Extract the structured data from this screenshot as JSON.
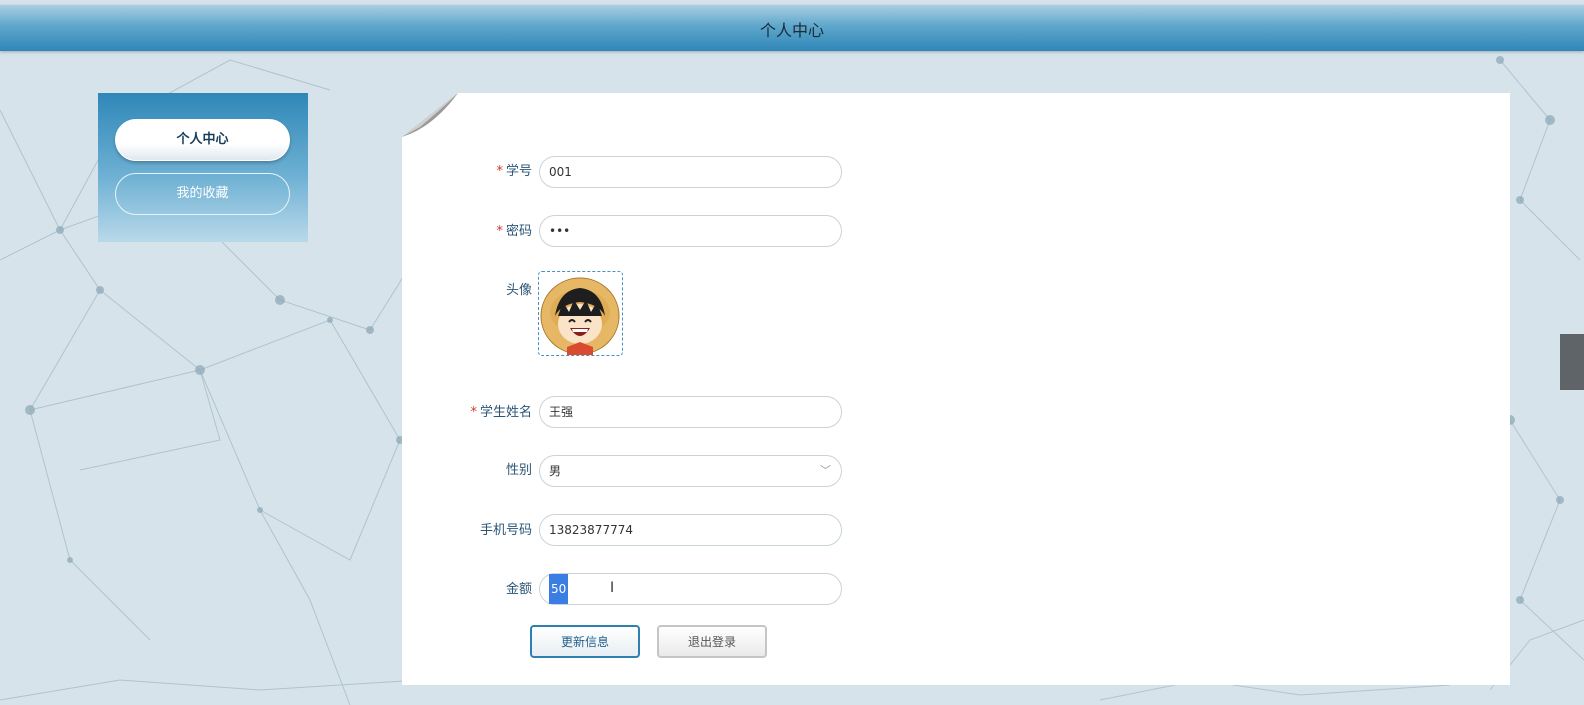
{
  "header": {
    "title": "个人中心"
  },
  "sidebar": {
    "items": [
      {
        "label": "个人中心",
        "active": true
      },
      {
        "label": "我的收藏",
        "active": false
      }
    ]
  },
  "form": {
    "student_id": {
      "label": "学号",
      "required": true,
      "value": "001"
    },
    "password": {
      "label": "密码",
      "required": true,
      "value": "•••"
    },
    "avatar": {
      "label": "头像",
      "icon": "cartoon-avatar"
    },
    "student_name": {
      "label": "学生姓名",
      "required": true,
      "value": "王强"
    },
    "gender": {
      "label": "性别",
      "required": false,
      "value": "男"
    },
    "phone": {
      "label": "手机号码",
      "required": false,
      "value": "13823877774"
    },
    "amount": {
      "label": "金额",
      "required": false,
      "value": "50"
    }
  },
  "buttons": {
    "update_label": "更新信息",
    "logout_label": "退出登录"
  },
  "colors": {
    "header_blue": "#2f87b8",
    "required_star": "#d7362a",
    "label_blue": "#2a5576"
  }
}
